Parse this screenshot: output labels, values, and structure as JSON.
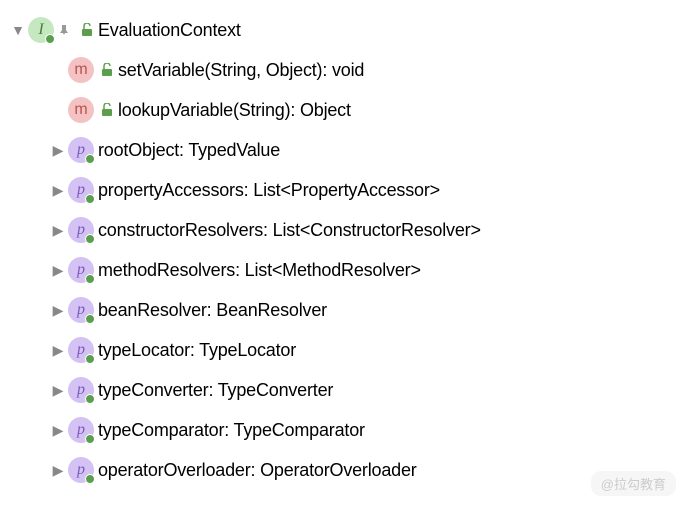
{
  "root": {
    "label": "EvaluationContext",
    "icon_letter": "I"
  },
  "children": [
    {
      "kind": "method",
      "icon_letter": "m",
      "has_arrow": false,
      "has_lock": true,
      "label": "setVariable(String, Object): void"
    },
    {
      "kind": "method",
      "icon_letter": "m",
      "has_arrow": false,
      "has_lock": true,
      "label": "lookupVariable(String): Object"
    },
    {
      "kind": "property",
      "icon_letter": "p",
      "has_arrow": true,
      "has_lock": false,
      "label": "rootObject: TypedValue"
    },
    {
      "kind": "property",
      "icon_letter": "p",
      "has_arrow": true,
      "has_lock": false,
      "label": "propertyAccessors: List<PropertyAccessor>"
    },
    {
      "kind": "property",
      "icon_letter": "p",
      "has_arrow": true,
      "has_lock": false,
      "label": "constructorResolvers: List<ConstructorResolver>"
    },
    {
      "kind": "property",
      "icon_letter": "p",
      "has_arrow": true,
      "has_lock": false,
      "label": "methodResolvers: List<MethodResolver>"
    },
    {
      "kind": "property",
      "icon_letter": "p",
      "has_arrow": true,
      "has_lock": false,
      "label": "beanResolver: BeanResolver"
    },
    {
      "kind": "property",
      "icon_letter": "p",
      "has_arrow": true,
      "has_lock": false,
      "label": "typeLocator: TypeLocator"
    },
    {
      "kind": "property",
      "icon_letter": "p",
      "has_arrow": true,
      "has_lock": false,
      "label": "typeConverter: TypeConverter"
    },
    {
      "kind": "property",
      "icon_letter": "p",
      "has_arrow": true,
      "has_lock": false,
      "label": "typeComparator: TypeComparator"
    },
    {
      "kind": "property",
      "icon_letter": "p",
      "has_arrow": true,
      "has_lock": false,
      "label": "operatorOverloader: OperatorOverloader"
    }
  ],
  "watermark": "@拉勾教育",
  "glyphs": {
    "arrow_right": "▶",
    "arrow_down": "▼",
    "lock_open": "🔓",
    "pin": "📌"
  }
}
